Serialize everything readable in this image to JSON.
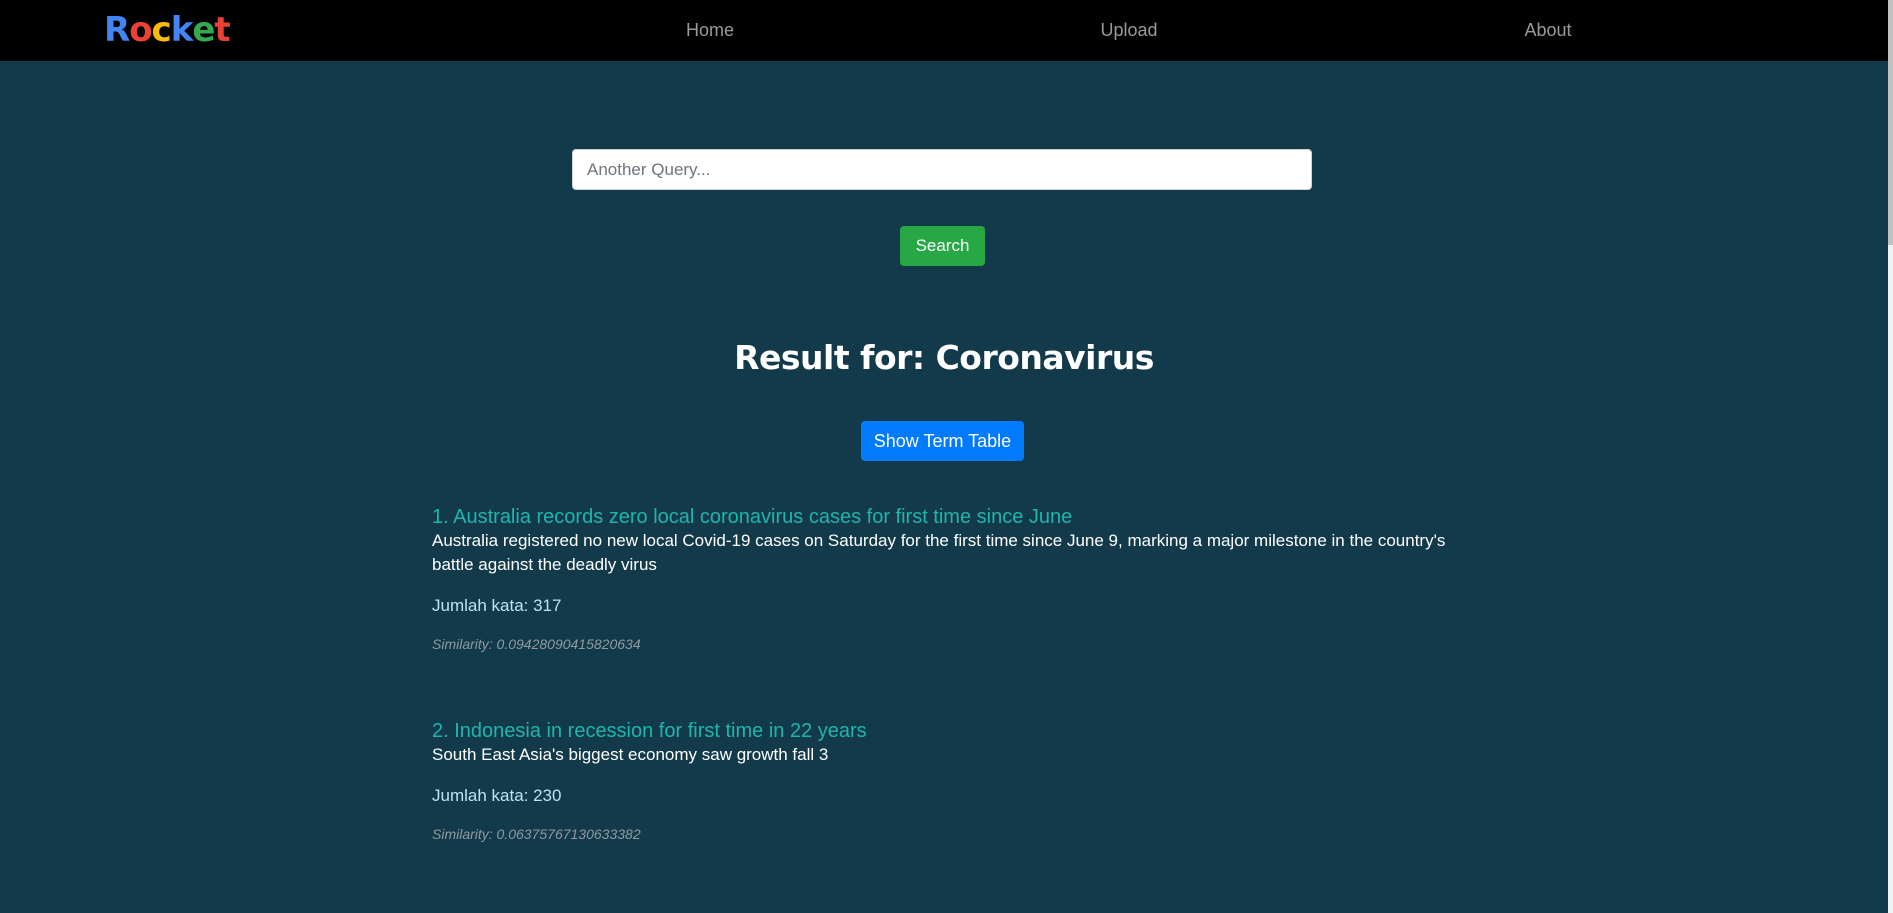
{
  "brand": {
    "letters": [
      {
        "char": "R",
        "color": "#4285f4"
      },
      {
        "char": "o",
        "color": "#ea4335"
      },
      {
        "char": "c",
        "color": "#fbbc05"
      },
      {
        "char": "k",
        "color": "#4285f4"
      },
      {
        "char": "e",
        "color": "#34a853"
      },
      {
        "char": "t",
        "color": "#ea4335"
      }
    ]
  },
  "nav": {
    "home": "Home",
    "upload": "Upload",
    "about": "About"
  },
  "search": {
    "placeholder": "Another Query...",
    "value": "",
    "button_label": "Search"
  },
  "result_heading": "Result for: Coronavirus",
  "term_table_button": "Show Term Table",
  "results": [
    {
      "title": "1. Australia records zero local coronavirus cases for first time since June",
      "description": "Australia registered no new local Covid-19 cases on Saturday for the first time since June 9, marking a major milestone in the country's battle against the deadly virus",
      "word_count": "Jumlah kata: 317",
      "similarity": "Similarity: 0.09428090415820634"
    },
    {
      "title": "2. Indonesia in recession for first time in 22 years",
      "description": "South East Asia's biggest economy saw growth fall 3",
      "word_count": "Jumlah kata: 230",
      "similarity": "Similarity: 0.06375767130633382"
    }
  ],
  "colors": {
    "navbar_bg": "#000000",
    "page_bg": "#133a4b",
    "search_button": "#28a745",
    "term_button": "#007bff",
    "result_link": "#1fb5ad"
  }
}
